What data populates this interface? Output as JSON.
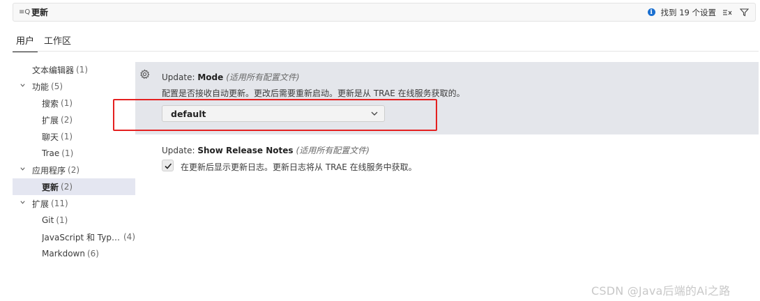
{
  "search": {
    "prefix_icon": "search-settings-icon",
    "prefix_glyph": "≡Q",
    "value": "更新",
    "result_text": "找到 19 个设置",
    "info_icon": "info-icon",
    "info_glyph": "i",
    "clear_icon": "clear-filter-icon",
    "filter_icon": "filter-icon"
  },
  "tabs": [
    {
      "label": "用户",
      "active": true
    },
    {
      "label": "工作区",
      "active": false
    }
  ],
  "tree": [
    {
      "label": "文本编辑器",
      "count": "(1)",
      "level": 0,
      "expandable": false
    },
    {
      "label": "功能",
      "count": "(5)",
      "level": 0,
      "expandable": true
    },
    {
      "label": "搜索",
      "count": "(1)",
      "level": 1
    },
    {
      "label": "扩展",
      "count": "(2)",
      "level": 1
    },
    {
      "label": "聊天",
      "count": "(1)",
      "level": 1
    },
    {
      "label": "Trae",
      "count": "(1)",
      "level": 1
    },
    {
      "label": "应用程序",
      "count": "(2)",
      "level": 0,
      "expandable": true
    },
    {
      "label": "更新",
      "count": "(2)",
      "level": 1,
      "selected": true
    },
    {
      "label": "扩展",
      "count": "(11)",
      "level": 0,
      "expandable": true
    },
    {
      "label": "Git",
      "count": "(1)",
      "level": 1
    },
    {
      "label": "JavaScript 和 Type...",
      "count": "(4)",
      "level": 1
    },
    {
      "label": "Markdown",
      "count": "(6)",
      "level": 1
    }
  ],
  "settings": {
    "mode": {
      "category": "Update: ",
      "name": "Mode",
      "scope": "(适用所有配置文件)",
      "description": "配置是否接收自动更新。更改后需要重新启动。更新是从 TRAE 在线服务获取的。",
      "value": "default"
    },
    "release_notes": {
      "category": "Update: ",
      "name": "Show Release Notes",
      "scope": "(适用所有配置文件)",
      "description": "在更新后显示更新日志。更新日志将从 TRAE 在线服务中获取。",
      "checked": true
    }
  },
  "watermark": "CSDN @Java后端的Ai之路",
  "colors": {
    "highlight": "#e42020",
    "selected_row": "#e4e6f1",
    "focused_setting": "#e4e6eb",
    "info": "#1a6fd0"
  }
}
